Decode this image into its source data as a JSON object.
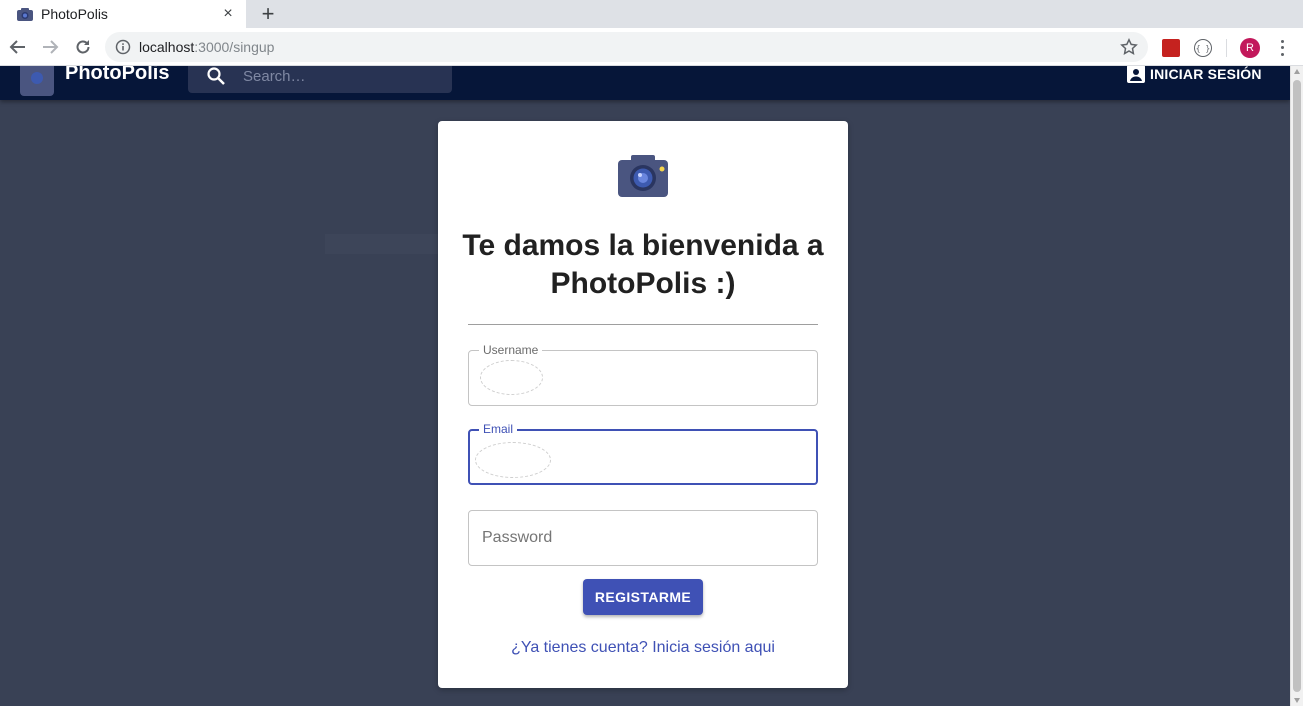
{
  "browser": {
    "tab_title": "PhotoPolis",
    "tab_close": "×",
    "new_tab": "+",
    "url_host": "localhost",
    "url_path": ":3000/singup",
    "profile_initial": "R"
  },
  "header": {
    "app_name": "PhotoPolis",
    "search_placeholder": "Search…",
    "login_label": "INICIAR SESIÓN"
  },
  "signup": {
    "title": "Te damos la bienvenida a PhotoPolis :)",
    "username_label": "Username",
    "email_label": "Email",
    "password_placeholder": "Password",
    "submit_label": "REGISTARME",
    "signin_link": "¿Ya tienes cuenta? Inicia sesión aqui"
  },
  "colors": {
    "appbar": "#061639",
    "page_bg": "#394155",
    "primary": "#3f51b5"
  }
}
